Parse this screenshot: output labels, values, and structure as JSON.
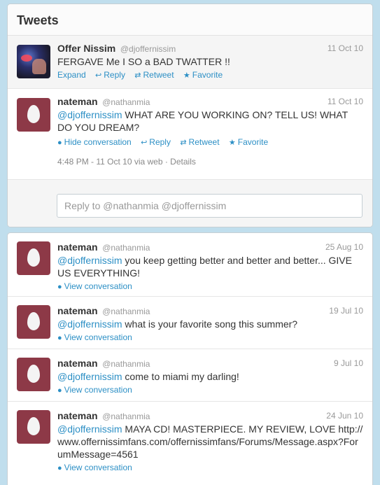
{
  "header": {
    "title": "Tweets"
  },
  "expanded": {
    "tweets": [
      {
        "name": "Offer Nissim",
        "handle": "@djoffernissim",
        "time": "11 Oct 10",
        "text": "FERGAVE Me I SO a BAD TWATTER !!",
        "actions": {
          "expand": "Expand",
          "reply": "Reply",
          "retweet": "Retweet",
          "favorite": "Favorite"
        }
      },
      {
        "name": "nateman",
        "handle": "@nathanmia",
        "time": "11 Oct 10",
        "mention": "@djoffernissim",
        "text": " WHAT ARE YOU WORKING ON? TELL US! WHAT DO YOU DREAM?",
        "actions": {
          "hide": "Hide conversation",
          "reply": "Reply",
          "retweet": "Retweet",
          "favorite": "Favorite"
        },
        "meta": "4:48 PM - 11 Oct 10 via web · Details"
      }
    ],
    "reply_placeholder": "Reply to @nathanmia @djoffernissim"
  },
  "timeline": [
    {
      "name": "nateman",
      "handle": "@nathanmia",
      "time": "25 Aug 10",
      "mention": "@djoffernissim",
      "text": " you keep getting better and better and better... GIVE US EVERYTHING!",
      "view": "View conversation"
    },
    {
      "name": "nateman",
      "handle": "@nathanmia",
      "time": "19 Jul 10",
      "mention": "@djoffernissim",
      "text": " what is your favorite song this summer?",
      "view": "View conversation"
    },
    {
      "name": "nateman",
      "handle": "@nathanmia",
      "time": "9 Jul 10",
      "mention": "@djoffernissim",
      "text": " come to miami my darling!",
      "view": "View conversation"
    },
    {
      "name": "nateman",
      "handle": "@nathanmia",
      "time": "24 Jun 10",
      "mention": "@djoffernissim",
      "text": " MAYA CD! MASTERPIECE. MY REVIEW, LOVE http://www.offernissimfans.com/offernissimfans/Forums/Message.aspx?ForumMessage=4561",
      "view": "View conversation"
    }
  ],
  "colors": {
    "background": "#c0deed",
    "link": "#2c8fc5",
    "egg_avatar": "#8d3947"
  },
  "icons": {
    "expand": "none",
    "reply": "reply-arrow-icon",
    "retweet": "retweet-icon",
    "favorite": "star-icon",
    "conversation": "speech-bubble-icon"
  }
}
